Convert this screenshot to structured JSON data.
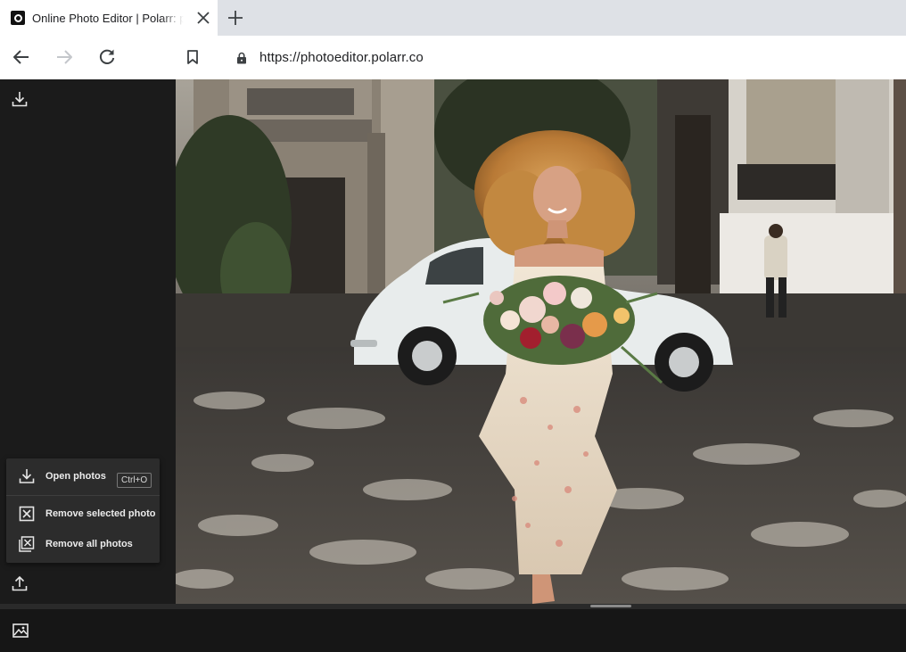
{
  "browser": {
    "tab_title": "Online Photo Editor | Polarr: pro",
    "url": "https://photoeditor.polarr.co"
  },
  "menu": {
    "open_label": "Open photos",
    "open_shortcut": "Ctrl+O",
    "remove_selected_label": "Remove selected photo",
    "remove_all_label": "Remove all photos"
  },
  "icons": {
    "favicon": "polarr-logo-icon",
    "close": "close-icon",
    "new_tab": "plus-icon",
    "back": "arrow-left-icon",
    "forward": "arrow-right-icon",
    "reload": "reload-icon",
    "bookmark": "bookmark-icon",
    "lock": "lock-icon",
    "import": "download-icon",
    "export": "upload-icon",
    "remove": "x-box-icon",
    "filmstrip": "image-icon"
  },
  "colors": {
    "app_bg": "#1b1b1b",
    "menu_bg": "#2c2c2c",
    "tabbar_bg": "#dee1e6"
  }
}
